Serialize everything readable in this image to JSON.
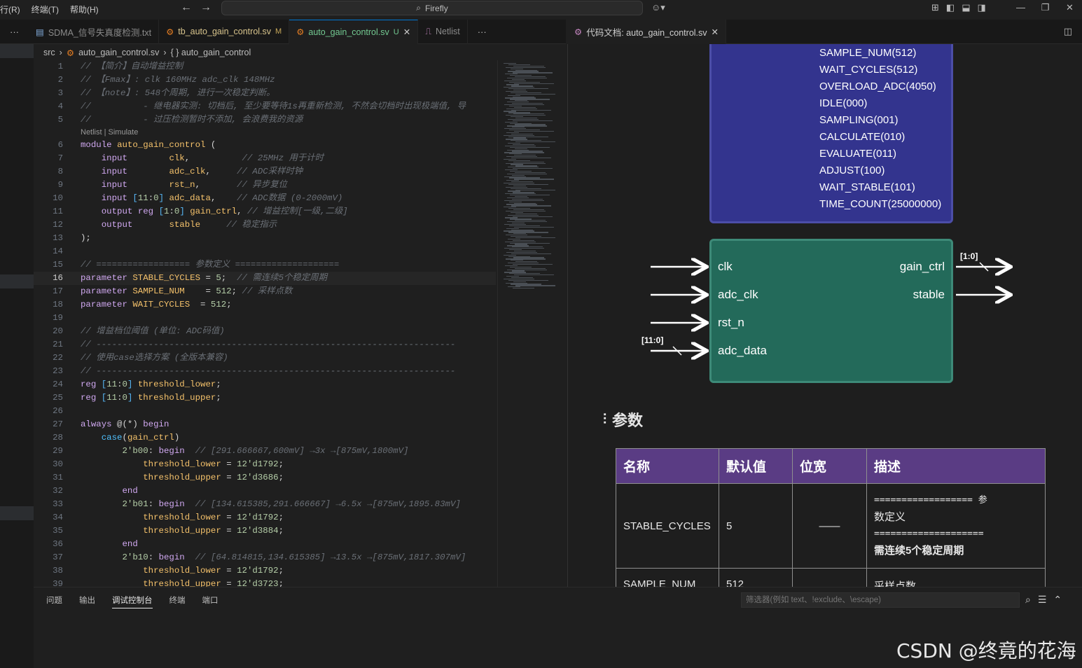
{
  "menu": {
    "items": [
      "行(R)",
      "终端(T)",
      "帮助(H)"
    ]
  },
  "command_center": {
    "label": "Firefly"
  },
  "tabs": [
    {
      "label": "SDMA_信号失真度检测.txt",
      "badge": ""
    },
    {
      "label": "tb_auto_gain_control.sv",
      "badge": "M"
    },
    {
      "label": "auto_gain_control.sv",
      "badge": "U"
    },
    {
      "label": "Netlist",
      "badge": ""
    }
  ],
  "preview_tab": {
    "label": "代码文档: auto_gain_control.sv"
  },
  "breadcrumb": {
    "folder": "src",
    "file": "auto_gain_control.sv",
    "symbol": "{ } auto_gain_control"
  },
  "codelens": "Netlist | Simulate",
  "code_lines": [
    {
      "n": "1",
      "t": "// 【简介】自动增益控制"
    },
    {
      "n": "2",
      "t": "// 【Fmax】: clk 160MHz adc_clk 148MHz"
    },
    {
      "n": "3",
      "t": "// 【note】: 548个周期, 进行一次稳定判断。"
    },
    {
      "n": "4",
      "t": "//          - 继电器实测: 切档后, 至少要等待1s再重新检测, 不然会切档时出现极端值, 导"
    },
    {
      "n": "5",
      "t": "//          - 过压检测暂时不添加, 会浪费我的资源"
    },
    {
      "n": "6",
      "t": "module auto_gain_control ("
    },
    {
      "n": "7",
      "t": "    input        clk,          // 25MHz 用于计时"
    },
    {
      "n": "8",
      "t": "    input        adc_clk,     // ADC采样时钟"
    },
    {
      "n": "9",
      "t": "    input        rst_n,       // 异步复位"
    },
    {
      "n": "10",
      "t": "    input [11:0] adc_data,    // ADC数据 (0-2000mV)"
    },
    {
      "n": "11",
      "t": "    output reg [1:0] gain_ctrl, // 增益控制[一级,二级]"
    },
    {
      "n": "12",
      "t": "    output       stable     // 稳定指示"
    },
    {
      "n": "13",
      "t": ");"
    },
    {
      "n": "14",
      "t": ""
    },
    {
      "n": "15",
      "t": "// ================== 参数定义 ===================="
    },
    {
      "n": "16",
      "t": "parameter STABLE_CYCLES = 5;  // 需连续5个稳定周期"
    },
    {
      "n": "17",
      "t": "parameter SAMPLE_NUM    = 512; // 采样点数"
    },
    {
      "n": "18",
      "t": "parameter WAIT_CYCLES  = 512;"
    },
    {
      "n": "19",
      "t": ""
    },
    {
      "n": "20",
      "t": "// 增益档位阈值 (单位: ADC码值)"
    },
    {
      "n": "21",
      "t": "// ---------------------------------------------------------------------"
    },
    {
      "n": "22",
      "t": "// 使用case选择方案 (全版本兼容)"
    },
    {
      "n": "23",
      "t": "// ---------------------------------------------------------------------"
    },
    {
      "n": "24",
      "t": "reg [11:0] threshold_lower;"
    },
    {
      "n": "25",
      "t": "reg [11:0] threshold_upper;"
    },
    {
      "n": "26",
      "t": ""
    },
    {
      "n": "27",
      "t": "always @(*) begin"
    },
    {
      "n": "28",
      "t": "    case(gain_ctrl)"
    },
    {
      "n": "29",
      "t": "        2'b00: begin  // [291.666667,600mV] →3x →[875mV,1800mV]"
    },
    {
      "n": "30",
      "t": "            threshold_lower = 12'd1792;"
    },
    {
      "n": "31",
      "t": "            threshold_upper = 12'd3686;"
    },
    {
      "n": "32",
      "t": "        end"
    },
    {
      "n": "33",
      "t": "        2'b01: begin  // [134.615385,291.666667] →6.5x →[875mV,1895.83mV]"
    },
    {
      "n": "34",
      "t": "            threshold_lower = 12'd1792;"
    },
    {
      "n": "35",
      "t": "            threshold_upper = 12'd3884;"
    },
    {
      "n": "36",
      "t": "        end"
    },
    {
      "n": "37",
      "t": "        2'b10: begin  // [64.814815,134.615385] →13.5x →[875mV,1817.307mV]"
    },
    {
      "n": "38",
      "t": "            threshold_lower = 12'd1792;"
    },
    {
      "n": "39",
      "t": "            threshold_upper = 12'd3723;"
    }
  ],
  "param_box_items": [
    "SAMPLE_NUM(512)",
    "WAIT_CYCLES(512)",
    "OVERLOAD_ADC(4050)",
    "IDLE(000)",
    "SAMPLING(001)",
    "CALCULATE(010)",
    "EVALUATE(011)",
    "ADJUST(100)",
    "WAIT_STABLE(101)",
    "TIME_COUNT(25000000)"
  ],
  "module_ports": {
    "inputs": [
      "clk",
      "adc_clk",
      "rst_n",
      "adc_data"
    ],
    "outputs": [
      "gain_ctrl",
      "stable"
    ],
    "adc_data_width": "[11:0]",
    "gain_ctrl_width": "[1:0]"
  },
  "params_heading": "参数",
  "param_table": {
    "headers": [
      "名称",
      "默认值",
      "位宽",
      "描述"
    ],
    "rows": [
      {
        "name": "STABLE_CYCLES",
        "default": "5",
        "width": "——",
        "desc1": "================== 参",
        "desc2": "数定义",
        "desc3": "====================",
        "desc4": "需连续5个稳定周期"
      },
      {
        "name": "SAMPLE_NUM",
        "default": "512",
        "width": "",
        "desc1": "采样点数"
      }
    ]
  },
  "panel": {
    "tabs": [
      "问题",
      "输出",
      "调试控制台",
      "终端",
      "端口"
    ],
    "active_tab": "调试控制台",
    "filter_placeholder": "筛选器(例如 text、!exclude、\\escape)"
  },
  "watermark": "CSDN @终竟的花海",
  "colors": {
    "accent": "#0078d4",
    "param_box": "#33348e",
    "module_box": "#236a5a",
    "table_header": "#5a3c84"
  }
}
